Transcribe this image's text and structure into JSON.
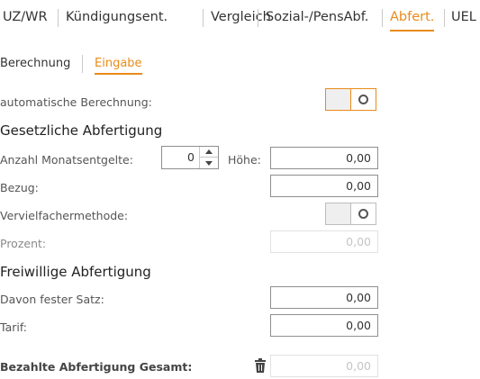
{
  "top_tabs": [
    {
      "label": "UZ/WR"
    },
    {
      "label": "Kündigungsent."
    },
    {
      "label": "Vergleich"
    },
    {
      "label": "Sozial-/PensAbf."
    },
    {
      "label": "Abfert.",
      "active": true
    },
    {
      "label": "UEL"
    }
  ],
  "sub_tabs": [
    {
      "label": "Berechnung"
    },
    {
      "label": "Eingabe",
      "active": true
    }
  ],
  "auto_calc": {
    "label": "automatische Berechnung:",
    "state": "on"
  },
  "gesetzlich": {
    "heading": "Gesetzliche Abfertigung",
    "anzahl_label": "Anzahl Monatsentgelte:",
    "anzahl_value": "0",
    "hoehe_label": "Höhe:",
    "hoehe_value": "0,00",
    "bezug_label": "Bezug:",
    "bezug_value": "0,00",
    "verviel_label": "Vervielfachermethode:",
    "verviel_state": "off",
    "prozent_label": "Prozent:",
    "prozent_value": "0,00"
  },
  "freiwillig": {
    "heading": "Freiwillige Abfertigung",
    "fester_label": "Davon fester Satz:",
    "fester_value": "0,00",
    "tarif_label": "Tarif:",
    "tarif_value": "0,00"
  },
  "gesamt": {
    "label": "Bezahlte Abfertigung Gesamt:",
    "value": "0,00"
  },
  "colors": {
    "accent": "#e98b1a",
    "text": "#333333",
    "muted": "#8a8a8a",
    "disabled": "#c5c5c5"
  },
  "icons": {
    "toggle_knob": "circle-icon",
    "delete": "trash-icon",
    "increment": "chevron-up-icon",
    "decrement": "chevron-down-icon"
  }
}
